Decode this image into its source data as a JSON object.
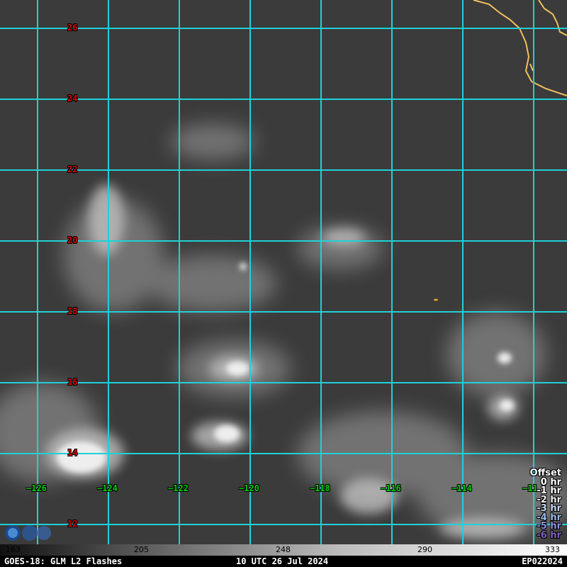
{
  "map": {
    "satellite": "GOES-18",
    "product": "GLM L2 Flashes",
    "latitudes": [
      "26",
      "24",
      "22",
      "20",
      "18",
      "16",
      "14",
      "12"
    ],
    "longitudes": [
      "−126",
      "−124",
      "−122",
      "−120",
      "−118",
      "−116",
      "−114",
      "−11"
    ],
    "grid_color": "#20d0d8",
    "coast_color": "#f0c060",
    "lat_label_color": "#e00000",
    "lon_label_color": "#00d000"
  },
  "legend": {
    "title": "Offset",
    "items": [
      {
        "label": "0 hr",
        "color": "#ffffff"
      },
      {
        "label": "-1 hr",
        "color": "#ffffff"
      },
      {
        "label": "-2 hr",
        "color": "#f0f0f0"
      },
      {
        "label": "-3 hr",
        "color": "#c8d8f0"
      },
      {
        "label": "-4 hr",
        "color": "#a0b8e8"
      },
      {
        "label": "-5 hr",
        "color": "#9090e0"
      },
      {
        "label": "-6 hr",
        "color": "#8060c0"
      }
    ]
  },
  "colorbar": {
    "ticks": [
      "163",
      "205",
      "248",
      "290",
      "333"
    ]
  },
  "footer": {
    "left": "GOES-18: GLM L2 Flashes",
    "center": "10 UTC 26 Jul 2024",
    "right": "EP022024"
  }
}
